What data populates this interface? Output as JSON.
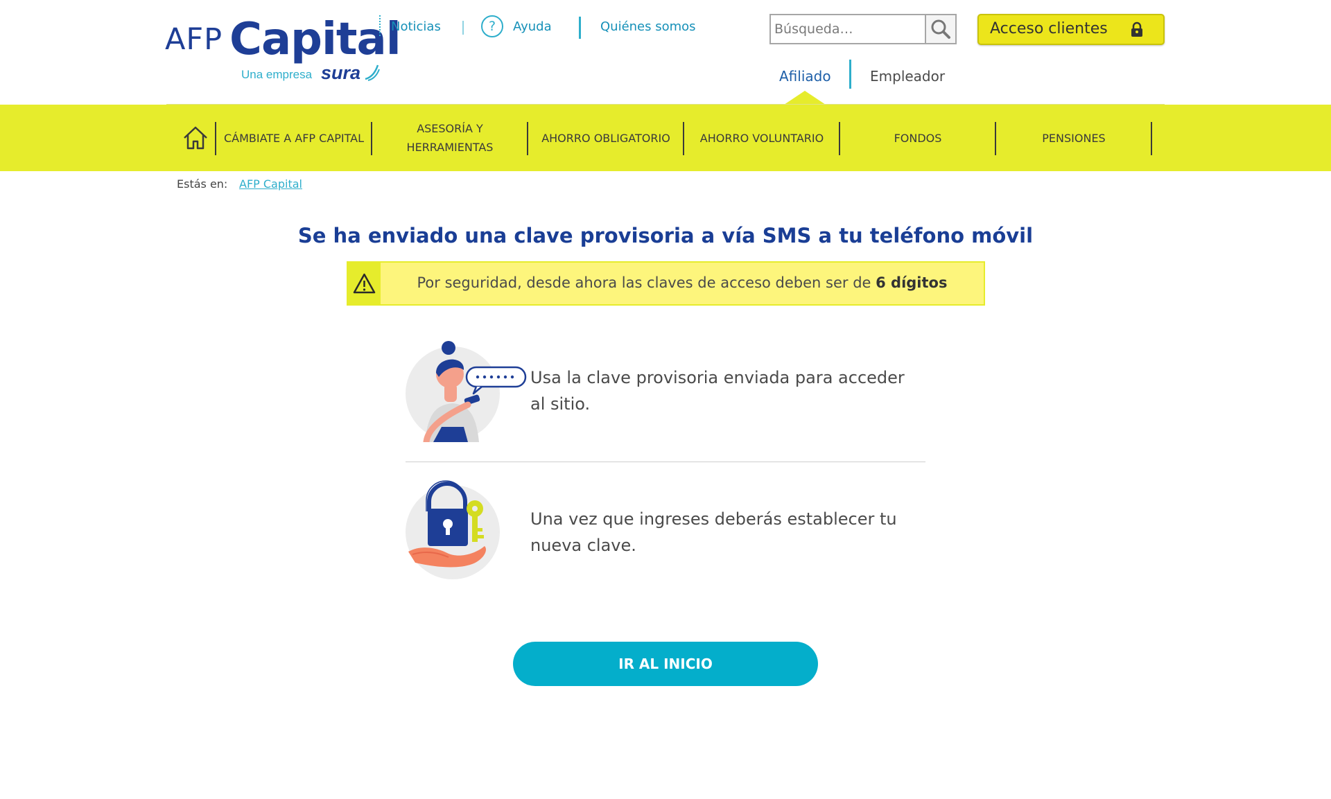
{
  "brand": {
    "name_prefix": "AFP",
    "name_main": "Capital",
    "tagline": "Una empresa",
    "partner": "sura",
    "colors": {
      "primary": "#1e3e96",
      "accent": "#2eaecb",
      "yellow": "#e6ec2c",
      "cta": "#04aecb"
    }
  },
  "top_links": {
    "news": "Noticias",
    "help": "Ayuda",
    "about": "Quiénes somos"
  },
  "search": {
    "placeholder": "Búsqueda…",
    "icon": "magnifier-icon"
  },
  "access": {
    "label": "Acceso clientes",
    "icon": "lock-icon"
  },
  "audience_tabs": {
    "affiliate": "Afiliado",
    "employer": "Empleador",
    "active": "Afiliado"
  },
  "nav": {
    "home_icon": "home-icon",
    "items": [
      "CÁMBIATE A AFP CAPITAL",
      "ASESORÍA Y HERRAMIENTAS",
      "AHORRO OBLIGATORIO",
      "AHORRO VOLUNTARIO",
      "FONDOS",
      "PENSIONES"
    ]
  },
  "breadcrumb": {
    "label": "Estás en:",
    "link": "AFP Capital"
  },
  "main": {
    "title": "Se ha enviado una clave provisoria a vía SMS a tu teléfono móvil",
    "notice": {
      "icon": "warning-icon",
      "text": "Por seguridad, desde ahora las claves de acceso deben ser de ",
      "emphasis": "6 dígitos"
    },
    "steps": [
      {
        "icon": "woman-phone-sms-illustration",
        "text": "Usa la clave provisoria enviada para acceder al sitio."
      },
      {
        "icon": "padlock-key-hand-illustration",
        "text": "Una vez que ingreses deberás establecer tu nueva clave."
      }
    ],
    "cta": "IR AL INICIO"
  }
}
